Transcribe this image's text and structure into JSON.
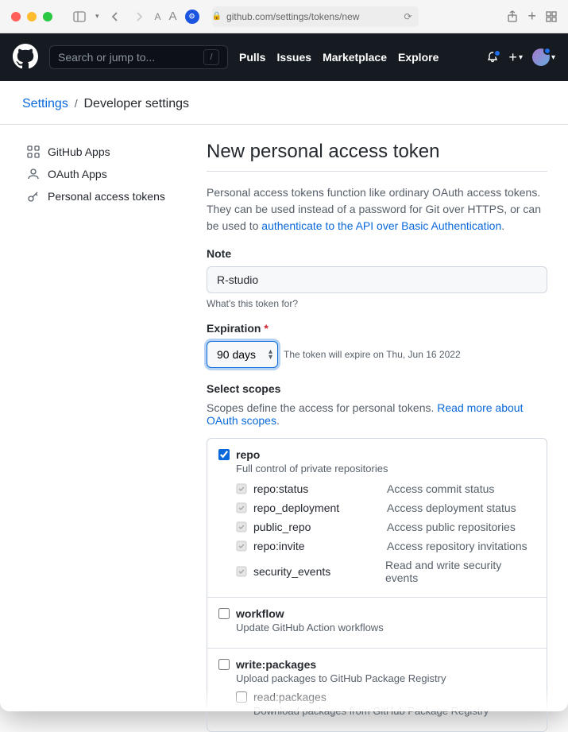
{
  "chrome": {
    "url": "github.com/settings/tokens/new"
  },
  "gh_header": {
    "search_placeholder": "Search or jump to...",
    "slash": "/",
    "nav": [
      "Pulls",
      "Issues",
      "Marketplace",
      "Explore"
    ]
  },
  "breadcrumb": {
    "settings": "Settings",
    "sep": "/",
    "current": "Developer settings"
  },
  "sidebar": {
    "items": [
      {
        "label": "GitHub Apps"
      },
      {
        "label": "OAuth Apps"
      },
      {
        "label": "Personal access tokens"
      }
    ]
  },
  "page": {
    "title": "New personal access token",
    "desc_pre": "Personal access tokens function like ordinary OAuth access tokens. They can be used instead of a password for Git over HTTPS, or can be used to ",
    "desc_link": "authenticate to the API over Basic Authentication",
    "desc_post": "."
  },
  "note": {
    "label": "Note",
    "value": "R-studio",
    "hint": "What's this token for?"
  },
  "expiration": {
    "label": "Expiration",
    "value": "90 days",
    "hint": "The token will expire on Thu, Jun 16 2022"
  },
  "scopes": {
    "heading": "Select scopes",
    "desc_pre": "Scopes define the access for personal tokens. ",
    "desc_link": "Read more about OAuth scopes",
    "desc_post": ".",
    "groups": [
      {
        "name": "repo",
        "checked": true,
        "sub": "Full control of private repositories",
        "items": [
          {
            "name": "repo:status",
            "desc": "Access commit status"
          },
          {
            "name": "repo_deployment",
            "desc": "Access deployment status"
          },
          {
            "name": "public_repo",
            "desc": "Access public repositories"
          },
          {
            "name": "repo:invite",
            "desc": "Access repository invitations"
          },
          {
            "name": "security_events",
            "desc": "Read and write security events"
          }
        ]
      },
      {
        "name": "workflow",
        "checked": false,
        "sub": "Update GitHub Action workflows",
        "items": []
      },
      {
        "name": "write:packages",
        "checked": false,
        "sub": "Upload packages to GitHub Package Registry",
        "nested": {
          "name": "read:packages",
          "sub": "Download packages from GitHub Package Registry"
        }
      }
    ]
  }
}
